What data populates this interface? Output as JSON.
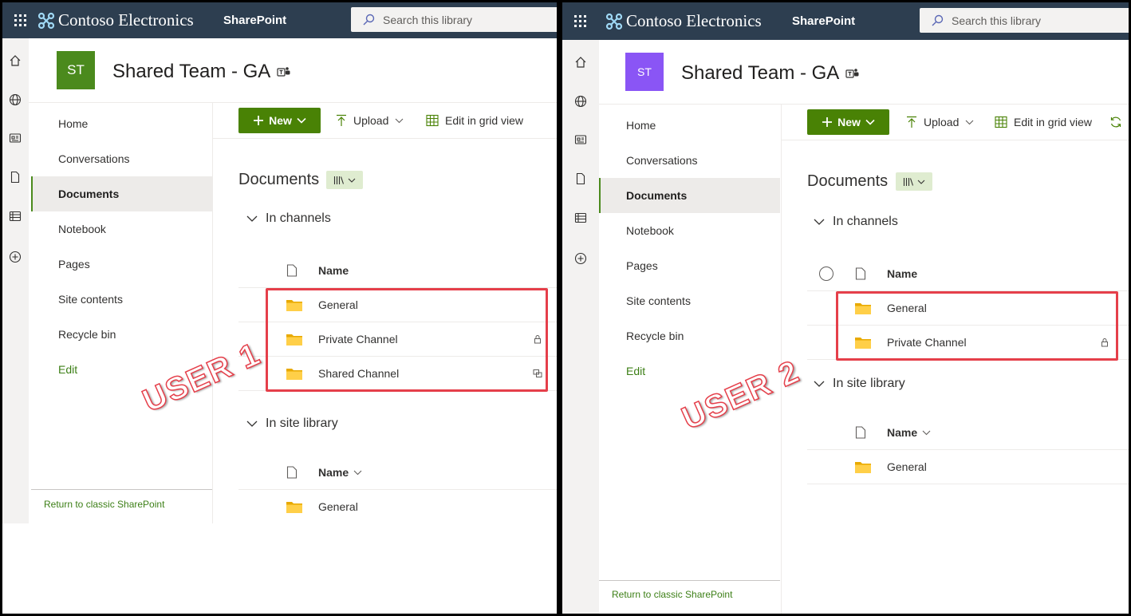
{
  "panel1": {
    "suite_bar": {
      "brand": "Contoso Electronics",
      "app": "SharePoint",
      "search_placeholder": "Search this library"
    },
    "site": {
      "logo_text": "ST",
      "title": "Shared Team - GA"
    },
    "nav": {
      "items": [
        "Home",
        "Conversations",
        "Documents",
        "Notebook",
        "Pages",
        "Site contents",
        "Recycle bin"
      ],
      "active": "Documents",
      "edit": "Edit",
      "footer": "Return to classic SharePoint"
    },
    "command_bar": {
      "new": "New",
      "upload": "Upload",
      "grid": "Edit in grid view"
    },
    "library_title": "Documents",
    "groups": [
      {
        "title": "In channels",
        "column": "Name",
        "rows": [
          {
            "name": "General",
            "status": ""
          },
          {
            "name": "Private Channel",
            "status": "lock-icon"
          },
          {
            "name": "Shared Channel",
            "status": "shared-icon"
          }
        ]
      },
      {
        "title": "In site library",
        "column": "Name",
        "rows": [
          {
            "name": "General",
            "status": ""
          }
        ]
      }
    ],
    "annotation": "USER 1"
  },
  "panel2": {
    "suite_bar": {
      "brand": "Contoso Electronics",
      "app": "SharePoint",
      "search_placeholder": "Search this library"
    },
    "site": {
      "logo_text": "ST",
      "title": "Shared Team - GA"
    },
    "nav": {
      "items": [
        "Home",
        "Conversations",
        "Documents",
        "Notebook",
        "Pages",
        "Site contents",
        "Recycle bin"
      ],
      "active": "Documents",
      "edit": "Edit",
      "footer": "Return to classic SharePoint"
    },
    "command_bar": {
      "new": "New",
      "upload": "Upload",
      "grid": "Edit in grid view"
    },
    "library_title": "Documents",
    "groups": [
      {
        "title": "In channels",
        "column": "Name",
        "rows": [
          {
            "name": "General",
            "status": ""
          },
          {
            "name": "Private Channel",
            "status": "lock-icon"
          }
        ]
      },
      {
        "title": "In site library",
        "column": "Name",
        "rows": [
          {
            "name": "General",
            "status": ""
          }
        ]
      }
    ],
    "annotation": "USER 2"
  },
  "colors": {
    "suite_bar": "#2d3e50",
    "accent": "#498205",
    "highlight": "#e53f4a",
    "logo_user1": "#4b8a1d",
    "logo_user2": "#8a55f5"
  }
}
